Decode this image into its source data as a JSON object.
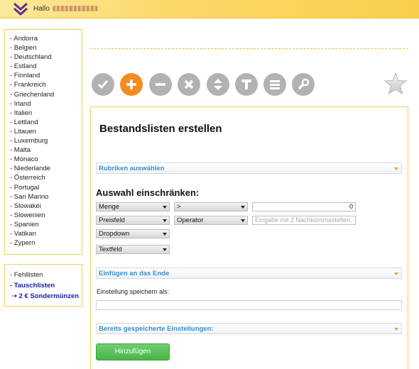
{
  "header": {
    "greeting": "Hallo",
    "logo_icon": "chevron-double-down-icon",
    "accent_color": "#f8cf4c"
  },
  "countries": [
    "- Andorra",
    "- Belgien",
    "- Deutschland",
    "- Estland",
    "- Finnland",
    "- Frankreich",
    "- Griechenland",
    "- Irland",
    "- Italien",
    "- Lettland",
    "- Litauen",
    "- Luxemburg",
    "- Malta",
    "- Monaco",
    "- Niederlande",
    "- Österreich",
    "- Portugal",
    "- San Marino",
    "- Slowakei",
    "- Slowenien",
    "- Spanien",
    "- Vatikan",
    "- Zypern"
  ],
  "lists": {
    "missing": "- Fehllisten",
    "swap": "- Tauschlisten",
    "special": "➝ 2 € Sondermünzen"
  },
  "toolbar": {
    "icons": [
      "check-icon",
      "plus-icon",
      "minus-icon",
      "close-icon",
      "sort-icon",
      "text-icon",
      "list-icon",
      "wrench-icon"
    ],
    "favorite_icon": "star-icon",
    "active_color": "#f58a1f",
    "inactive_color": "#b2b2b2"
  },
  "main": {
    "title": "Bestandslisten erstellen",
    "select_columns": "Rubriken auswählen",
    "restrict_title": "Auswahl einschränken:",
    "row1": {
      "field": "Menge",
      "operator": ">",
      "value": "0"
    },
    "row2": {
      "field": "Preisfeld",
      "operator": "Operator",
      "placeholder": "Eingabe mit 2 Nachkommastellen."
    },
    "row3": {
      "field": "Dropdown"
    },
    "row4": {
      "field": "Textfeld"
    },
    "insert": "Einfügen an das Ende",
    "save_label": "Einstellung speichern als:",
    "saved_settings": "Bereits gespeicherte Einstellungen:",
    "add_button": "Hinzufügen"
  }
}
